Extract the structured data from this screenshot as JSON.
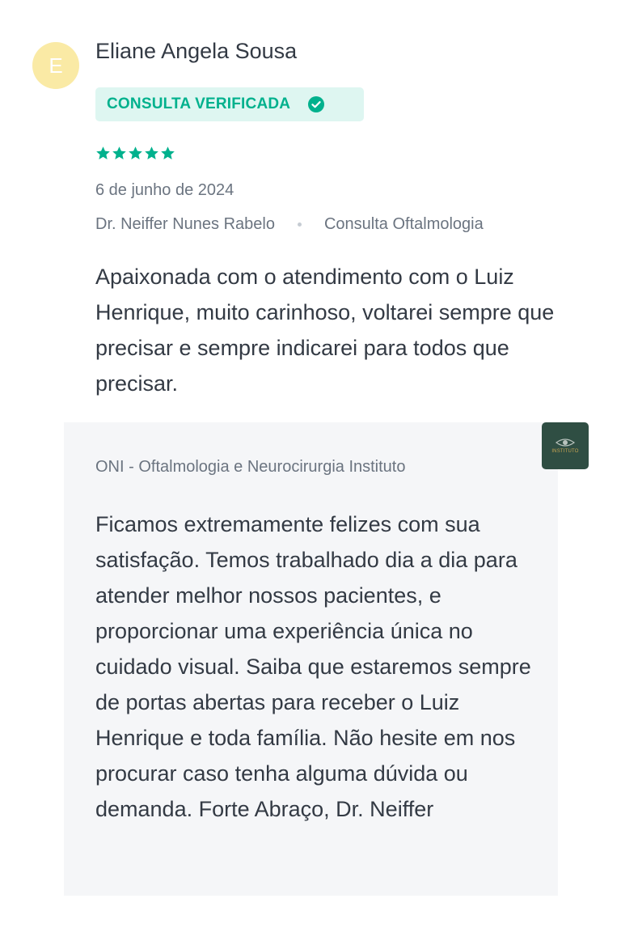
{
  "review": {
    "avatar_initial": "E",
    "reviewer_name": "Eliane Angela Sousa",
    "verified_label": "CONSULTA VERIFICADA",
    "rating": 5,
    "rating_max": 5,
    "date": "6 de junho de 2024",
    "doctor": "Dr. Neiffer Nunes Rabelo",
    "service": "Consulta Oftalmologia",
    "text": "Apaixonada com o atendimento com o Luiz Henrique, muito carinhoso, voltarei sempre que precisar e sempre indicarei para todos que precisar."
  },
  "reply": {
    "author": "ONI - Oftalmologia e Neurocirurgia Instituto",
    "logo_text": "INSTITUTO",
    "text": "Ficamos extremamente felizes com sua satisfação. Temos trabalhado dia a dia para atender melhor nossos pacientes, e proporcionar uma experiência única no cuidado visual. Saiba que estaremos sempre de portas abertas para receber o Luiz Henrique e toda família. Não hesite em nos procurar caso tenha alguma dúvida ou demanda. Forte Abraço, Dr. Neiffer"
  },
  "icons": {
    "verified": "check-circle-icon",
    "rating": "star-icon",
    "clinic_logo": "eye-icon"
  },
  "colors": {
    "accent": "#00b18d",
    "badge_background": "#def6f1",
    "avatar_background": "#faeaa5",
    "reply_background": "#f5f6f8",
    "logo_background": "#2f4e43"
  }
}
